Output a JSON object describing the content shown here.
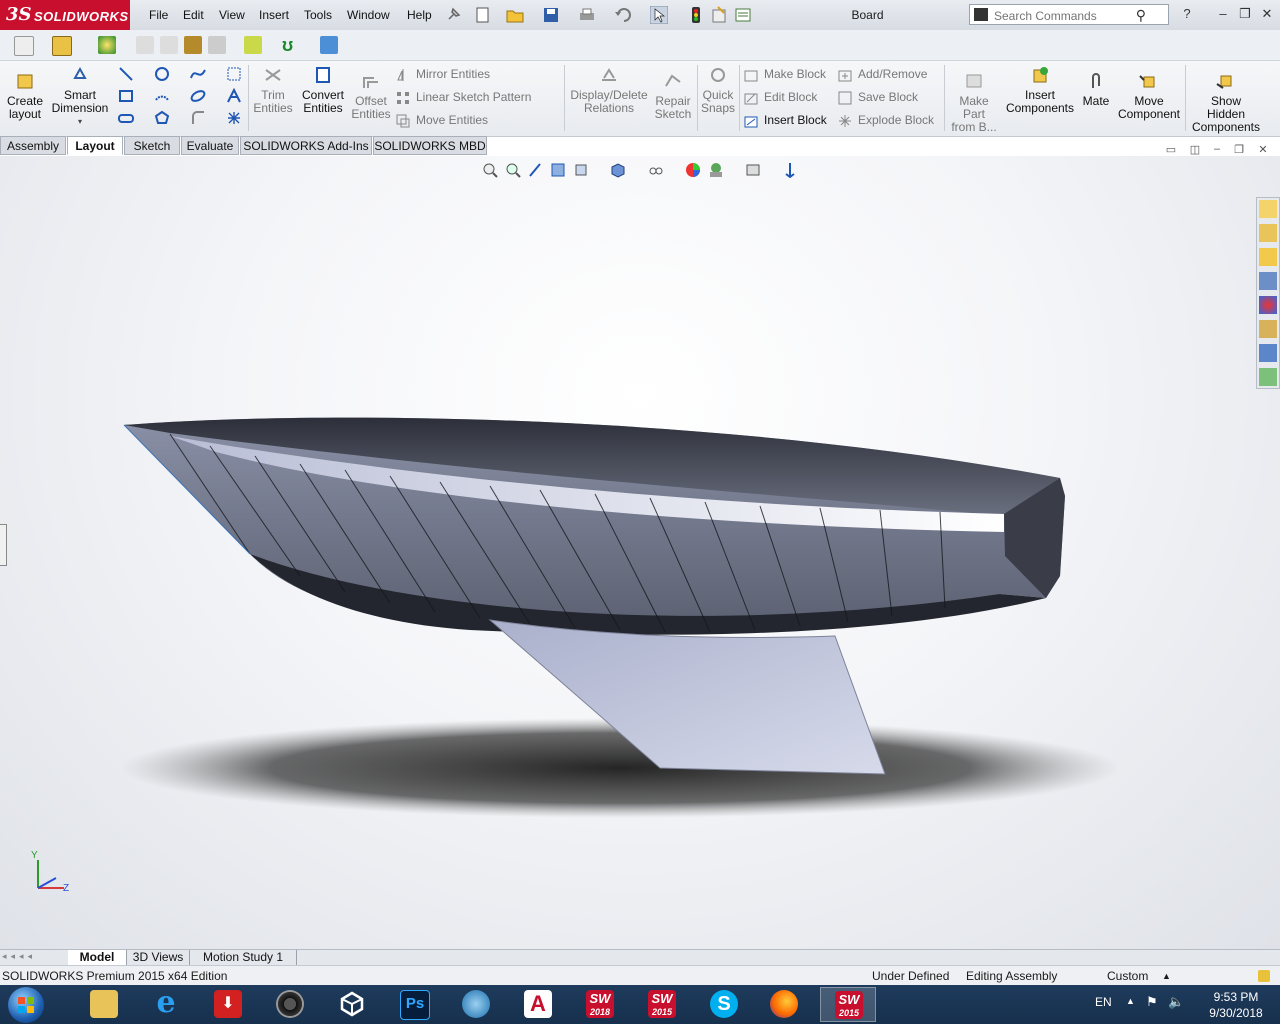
{
  "app": {
    "brand_ds": "3S",
    "brand_name": "SOLIDWORKS",
    "document_title": "Board"
  },
  "menu": [
    "File",
    "Edit",
    "View",
    "Insert",
    "Tools",
    "Window",
    "Help"
  ],
  "search": {
    "placeholder": "Search Commands"
  },
  "command_manager": {
    "big_buttons": [
      {
        "label": "Create\nlayout",
        "enabled": true
      },
      {
        "label": "Smart\nDimension",
        "enabled": true
      },
      {
        "label": "Trim\nEntities",
        "enabled": false
      },
      {
        "label": "Convert\nEntities",
        "enabled": true
      },
      {
        "label": "Offset\nEntities",
        "enabled": false
      },
      {
        "label": "Display/Delete\nRelations",
        "enabled": false
      },
      {
        "label": "Repair\nSketch",
        "enabled": false
      },
      {
        "label": "Quick\nSnaps",
        "enabled": false
      },
      {
        "label": "Make\nPart\nfrom B...",
        "enabled": false
      },
      {
        "label": "Insert\nComponents",
        "enabled": true
      },
      {
        "label": "Mate",
        "enabled": true
      },
      {
        "label": "Move\nComponent",
        "enabled": true
      },
      {
        "label": "Show\nHidden\nComponents",
        "enabled": true
      }
    ],
    "mirror_group": [
      "Mirror Entities",
      "Linear Sketch Pattern",
      "Move Entities"
    ],
    "block_group_a": [
      "Make Block",
      "Edit Block",
      "Insert Block"
    ],
    "block_group_b": [
      "Add/Remove",
      "Save Block",
      "Explode Block"
    ]
  },
  "tabs": [
    {
      "label": "Assembly",
      "active": false
    },
    {
      "label": "Layout",
      "active": true
    },
    {
      "label": "Sketch",
      "active": false
    },
    {
      "label": "Evaluate",
      "active": false
    },
    {
      "label": "SOLIDWORKS Add-Ins",
      "active": false
    },
    {
      "label": "SOLIDWORKS MBD",
      "active": false
    }
  ],
  "bottom_tabs": [
    {
      "label": "Model",
      "active": true
    },
    {
      "label": "3D Views",
      "active": false
    },
    {
      "label": "Motion Study 1",
      "active": false
    }
  ],
  "status_bar": {
    "edition": "SOLIDWORKS Premium 2015 x64 Edition",
    "definition": "Under Defined",
    "mode": "Editing Assembly",
    "units": "Custom"
  },
  "triad": {
    "y": "Y",
    "z": "Z"
  },
  "taskbar": {
    "items": [
      {
        "name": "file-explorer",
        "label": ""
      },
      {
        "name": "internet-explorer",
        "label": "e"
      },
      {
        "name": "download-manager",
        "label": "⬇"
      },
      {
        "name": "camera-app",
        "label": ""
      },
      {
        "name": "unity",
        "label": ""
      },
      {
        "name": "photoshop",
        "label": "Ps"
      },
      {
        "name": "globe-app",
        "label": ""
      },
      {
        "name": "autocad",
        "label": "A"
      },
      {
        "name": "solidworks-2018",
        "label": "SW",
        "sub": "2018"
      },
      {
        "name": "solidworks-2015-a",
        "label": "SW",
        "sub": "2015"
      },
      {
        "name": "skype",
        "label": "S"
      },
      {
        "name": "firefox",
        "label": ""
      },
      {
        "name": "solidworks-2015-b",
        "label": "SW",
        "sub": "2015"
      }
    ],
    "language": "EN",
    "time": "9:53 PM",
    "date": "9/30/2018"
  },
  "colors": {
    "brand_red": "#c8102e",
    "taskbar": "#1a3555",
    "hull_light": "#b9bfd8",
    "hull_dark": "#2a2d36"
  }
}
